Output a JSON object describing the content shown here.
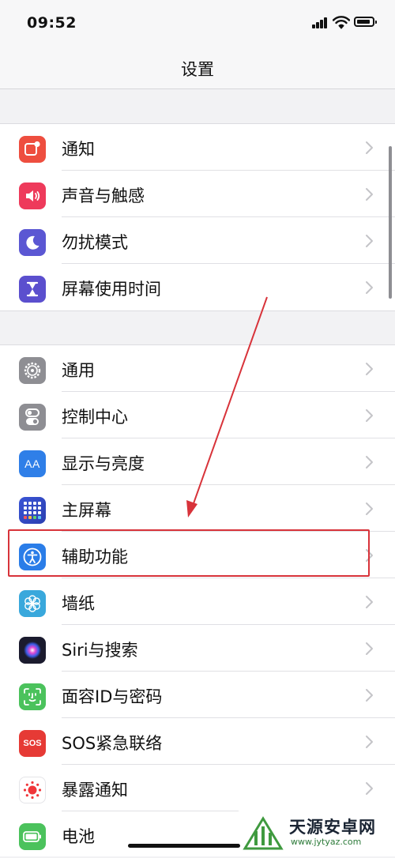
{
  "status_bar": {
    "time": "09:52"
  },
  "nav": {
    "title": "设置"
  },
  "group1": [
    {
      "label": "通知",
      "icon": "notification-icon",
      "color": "#ee4e3f"
    },
    {
      "label": "声音与触感",
      "icon": "sound-icon",
      "color": "#ee3a5b"
    },
    {
      "label": "勿扰模式",
      "icon": "moon-icon",
      "color": "#5b57d3"
    },
    {
      "label": "屏幕使用时间",
      "icon": "hourglass-icon",
      "color": "#5b4fce"
    }
  ],
  "group2": [
    {
      "label": "通用",
      "icon": "gear-icon",
      "color": "#8e8e93"
    },
    {
      "label": "控制中心",
      "icon": "toggles-icon",
      "color": "#8e8e93"
    },
    {
      "label": "显示与亮度",
      "icon": "display-icon",
      "color": "#2f7fe8",
      "icon_text": "AA"
    },
    {
      "label": "主屏幕",
      "icon": "home-screen-icon",
      "color": "#3a55d6"
    },
    {
      "label": "辅助功能",
      "icon": "accessibility-icon",
      "color": "#2a7de8",
      "highlighted": true
    },
    {
      "label": "墙纸",
      "icon": "wallpaper-icon",
      "color": "#39a8dc"
    },
    {
      "label": "Siri与搜索",
      "icon": "siri-icon",
      "color": "#1b1b2e"
    },
    {
      "label": "面容ID与密码",
      "icon": "face-id-icon",
      "color": "#4bc25c"
    },
    {
      "label": "SOS紧急联络",
      "icon": "sos-icon",
      "color": "#e63a35",
      "icon_text": "SOS"
    },
    {
      "label": "暴露通知",
      "icon": "exposure-icon",
      "color": "#ffffff"
    },
    {
      "label": "电池",
      "icon": "battery-icon",
      "color": "#4bc25c"
    }
  ],
  "annotation": {
    "color": "#d8333a"
  },
  "watermark": {
    "name": "天源安卓网",
    "url": "www.jytyaz.com"
  }
}
